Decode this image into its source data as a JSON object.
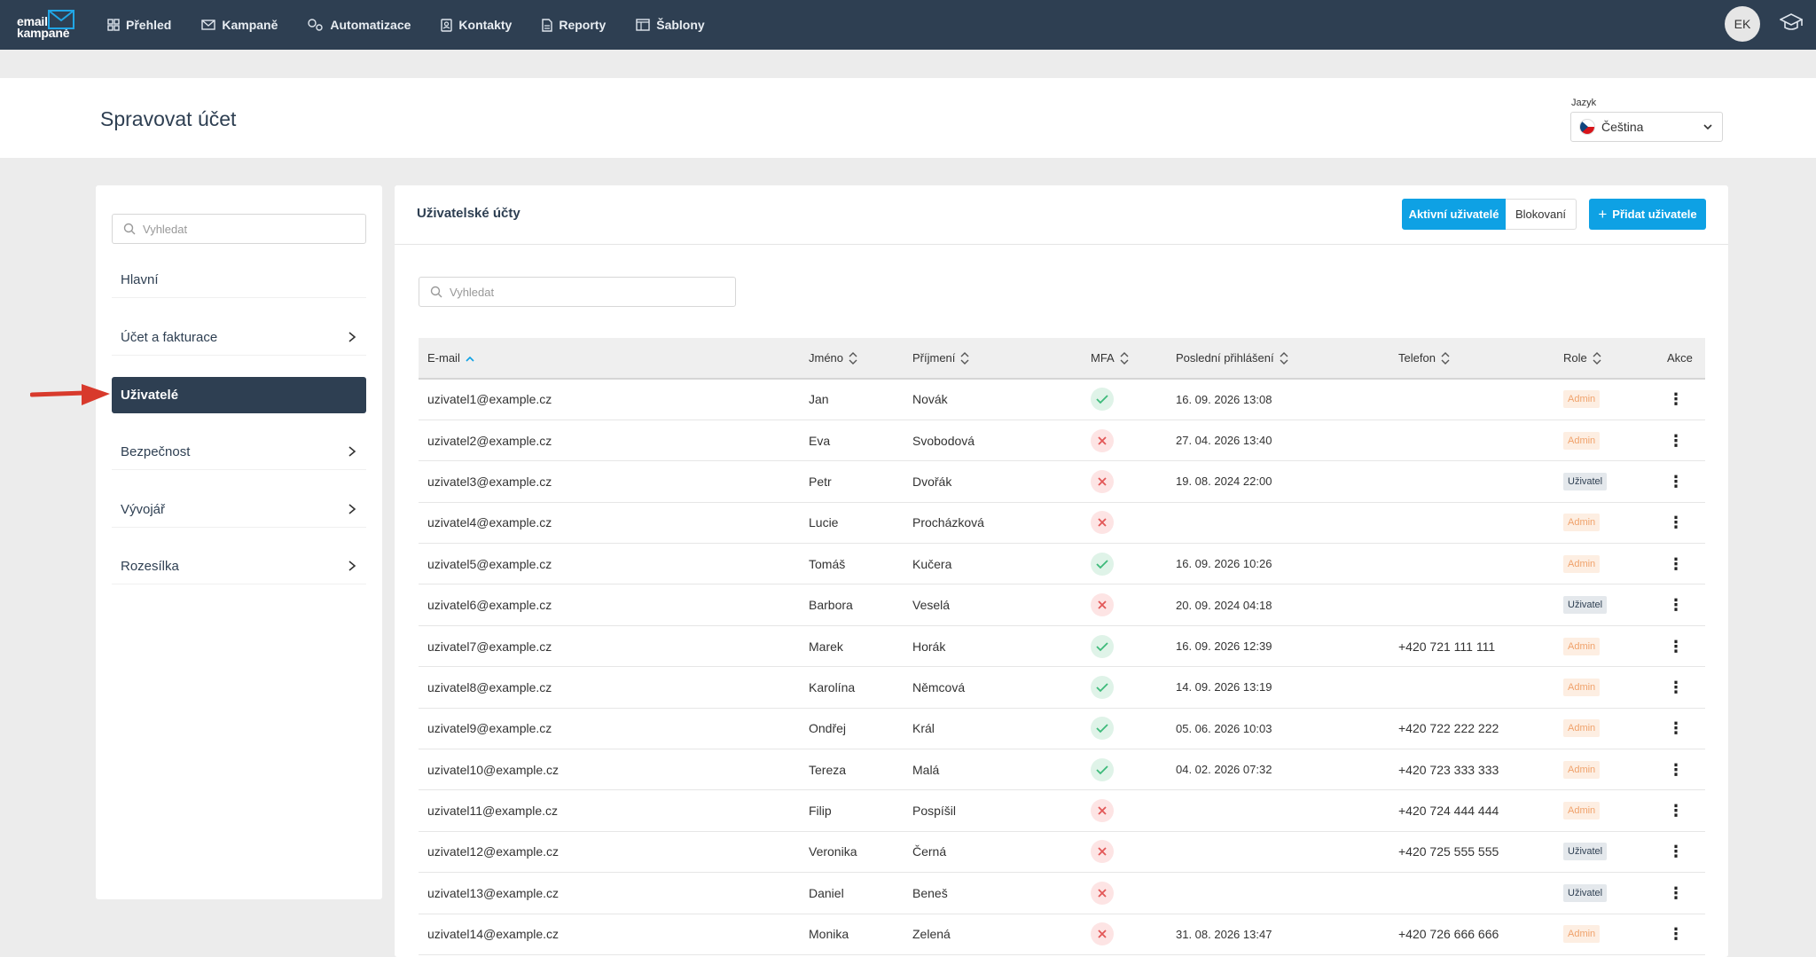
{
  "brand": {
    "line1": "email",
    "line2": "kampaně"
  },
  "nav": [
    {
      "label": "Přehled",
      "icon": "grid-icon"
    },
    {
      "label": "Kampaně",
      "icon": "envelope-icon"
    },
    {
      "label": "Automatizace",
      "icon": "automation-icon"
    },
    {
      "label": "Kontakty",
      "icon": "contacts-icon"
    },
    {
      "label": "Reporty",
      "icon": "report-icon"
    },
    {
      "label": "Šablony",
      "icon": "template-icon"
    }
  ],
  "user": {
    "initials": "EK"
  },
  "header": {
    "title": "Spravovat účet",
    "language_label": "Jazyk",
    "language_value": "Čeština"
  },
  "sidebar": {
    "search_placeholder": "Vyhledat",
    "items": [
      {
        "label": "Hlavní",
        "has_chevron": false,
        "active": false
      },
      {
        "label": "Účet a fakturace",
        "has_chevron": true,
        "active": false
      },
      {
        "label": "Uživatelé",
        "has_chevron": false,
        "active": true
      },
      {
        "label": "Bezpečnost",
        "has_chevron": true,
        "active": false
      },
      {
        "label": "Vývojář",
        "has_chevron": true,
        "active": false
      },
      {
        "label": "Rozesílka",
        "has_chevron": true,
        "active": false
      }
    ]
  },
  "main": {
    "title": "Uživatelské účty",
    "filter_active": "Aktivní uživatelé",
    "filter_blocked": "Blokovaní",
    "add_button": "Přidat uživatele",
    "search_placeholder": "Vyhledat",
    "columns": [
      "E-mail",
      "Jméno",
      "Příjmení",
      "MFA",
      "Poslední přihlášení",
      "Telefon",
      "Role",
      "Akce"
    ],
    "rows": [
      {
        "email": "uzivatel1@example.cz",
        "first": "Jan",
        "last": "Novák",
        "mfa": true,
        "login": "16. 09. 2026 13:08",
        "phone": "",
        "role": "Admin"
      },
      {
        "email": "uzivatel2@example.cz",
        "first": "Eva",
        "last": "Svobodová",
        "mfa": false,
        "login": "27. 04. 2026 13:40",
        "phone": "",
        "role": "Admin"
      },
      {
        "email": "uzivatel3@example.cz",
        "first": "Petr",
        "last": "Dvořák",
        "mfa": false,
        "login": "19. 08. 2024 22:00",
        "phone": "",
        "role": "Uživatel"
      },
      {
        "email": "uzivatel4@example.cz",
        "first": "Lucie",
        "last": "Procházková",
        "mfa": false,
        "login": "",
        "phone": "",
        "role": "Admin"
      },
      {
        "email": "uzivatel5@example.cz",
        "first": "Tomáš",
        "last": "Kučera",
        "mfa": true,
        "login": "16. 09. 2026 10:26",
        "phone": "",
        "role": "Admin"
      },
      {
        "email": "uzivatel6@example.cz",
        "first": "Barbora",
        "last": "Veselá",
        "mfa": false,
        "login": "20. 09. 2024 04:18",
        "phone": "",
        "role": "Uživatel"
      },
      {
        "email": "uzivatel7@example.cz",
        "first": "Marek",
        "last": "Horák",
        "mfa": true,
        "login": "16. 09. 2026 12:39",
        "phone": "+420 721 111 111",
        "role": "Admin"
      },
      {
        "email": "uzivatel8@example.cz",
        "first": "Karolína",
        "last": "Němcová",
        "mfa": true,
        "login": "14. 09. 2026 13:19",
        "phone": "",
        "role": "Admin"
      },
      {
        "email": "uzivatel9@example.cz",
        "first": "Ondřej",
        "last": "Král",
        "mfa": true,
        "login": "05. 06. 2026 10:03",
        "phone": "+420 722 222 222",
        "role": "Admin"
      },
      {
        "email": "uzivatel10@example.cz",
        "first": "Tereza",
        "last": "Malá",
        "mfa": true,
        "login": "04. 02. 2026 07:32",
        "phone": "+420 723 333 333",
        "role": "Admin"
      },
      {
        "email": "uzivatel11@example.cz",
        "first": "Filip",
        "last": "Pospíšil",
        "mfa": false,
        "login": "",
        "phone": "+420 724 444 444",
        "role": "Admin"
      },
      {
        "email": "uzivatel12@example.cz",
        "first": "Veronika",
        "last": "Černá",
        "mfa": false,
        "login": "",
        "phone": "+420 725 555 555",
        "role": "Uživatel"
      },
      {
        "email": "uzivatel13@example.cz",
        "first": "Daniel",
        "last": "Beneš",
        "mfa": false,
        "login": "",
        "phone": "",
        "role": "Uživatel"
      },
      {
        "email": "uzivatel14@example.cz",
        "first": "Monika",
        "last": "Zelená",
        "mfa": false,
        "login": "31. 08. 2026 13:47",
        "phone": "+420 726 666 666",
        "role": "Admin"
      }
    ]
  },
  "colors": {
    "nav_bg": "#2e3f52",
    "accent": "#0ea1e4",
    "mfa_ok": "#3dba7a",
    "mfa_no": "#e25757",
    "admin_badge": "#f0a26b",
    "pointer_arrow": "#d83a2c"
  }
}
